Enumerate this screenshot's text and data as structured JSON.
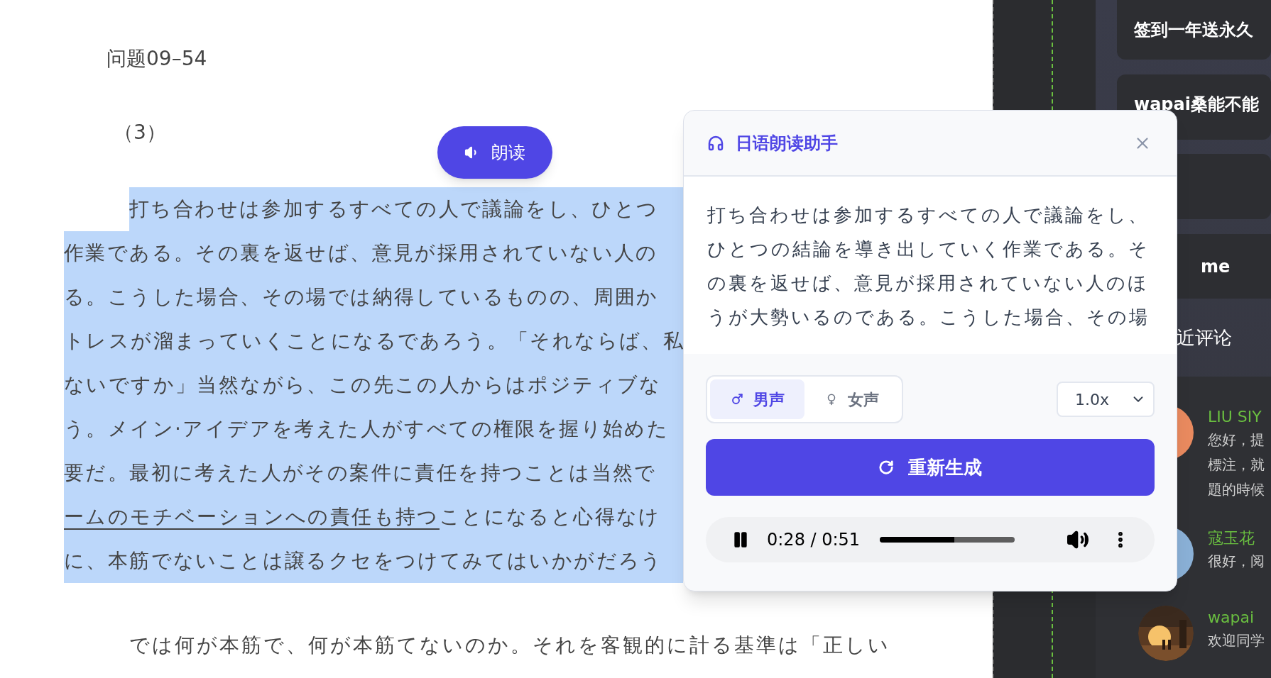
{
  "article": {
    "title": "问题09–54",
    "number": "（3）",
    "lines": [
      {
        "highlighted": true,
        "indent": true,
        "parts": [
          {
            "text": "打ち合わせは参加するすべての人で議論をし、ひとつ",
            "underlined": false
          }
        ]
      },
      {
        "highlighted": true,
        "indent": false,
        "parts": [
          {
            "text": "作業である。その裏を返せば、意見が採用されていない人の",
            "underlined": false
          }
        ]
      },
      {
        "highlighted": true,
        "indent": false,
        "parts": [
          {
            "text": "る。こうした場合、その場では納得しているものの、周囲か",
            "underlined": false
          }
        ]
      },
      {
        "highlighted": true,
        "indent": false,
        "parts": [
          {
            "text": "トレスが溜まっていくことになるであろう。「それならば、私",
            "underlined": false
          }
        ]
      },
      {
        "highlighted": true,
        "indent": false,
        "parts": [
          {
            "text": "ないですか」当然ながら、この先この人からはポジティブな",
            "underlined": false
          }
        ]
      },
      {
        "highlighted": true,
        "indent": false,
        "parts": [
          {
            "text": "う。メイン·アイデアを考えた人がすべての権限を握り始めた",
            "underlined": false
          }
        ]
      },
      {
        "highlighted": true,
        "indent": false,
        "parts": [
          {
            "text": "要だ。最初に考えた人がその案件に責任を持つことは当然で",
            "underlined": false
          }
        ]
      },
      {
        "highlighted": true,
        "indent": false,
        "parts": [
          {
            "text": "ームのモチベーションへの責任も持つ",
            "underlined": true
          },
          {
            "text": "ことになると心得なけ",
            "underlined": false
          }
        ]
      },
      {
        "highlighted": true,
        "indent": false,
        "parts": [
          {
            "text": "に、本筋でないことは譲るクセをつけてみてはいかがだろう",
            "underlined": false
          }
        ]
      }
    ],
    "next_line": "では何が本筋で、何が本筋てないのか。それを客観的に計る基準は「正しい"
  },
  "read_button": {
    "label": "朗读"
  },
  "panel": {
    "title": "日语朗读助手",
    "text": "打ち合わせは参加するすべての人で議論をし、ひとつの結論を導き出していく作業である。その裏を返せば、意見が採用されていない人のほうが大勢いるのである。こうした場合、その場",
    "voices": [
      {
        "label": "男声",
        "kind": "male",
        "selected": true
      },
      {
        "label": "女声",
        "kind": "female",
        "selected": false
      }
    ],
    "speed": "1.0x",
    "regenerate": "重新生成",
    "player": {
      "playing": true,
      "time": "0:28 / 0:51",
      "level": 0.55
    }
  },
  "sidebar": {
    "cards": [
      "签到一年送永久",
      "wapai桑能不能"
    ],
    "section": "me",
    "comments_title": "近评论",
    "comments": [
      {
        "name": "LIU SIY",
        "lines": [
          "您好，提",
          "標注，就",
          "題的時候"
        ]
      },
      {
        "name": "寇玉花",
        "lines": [
          "很好，阅"
        ]
      },
      {
        "name": "wapai",
        "lines": [
          "欢迎同学"
        ]
      }
    ]
  }
}
